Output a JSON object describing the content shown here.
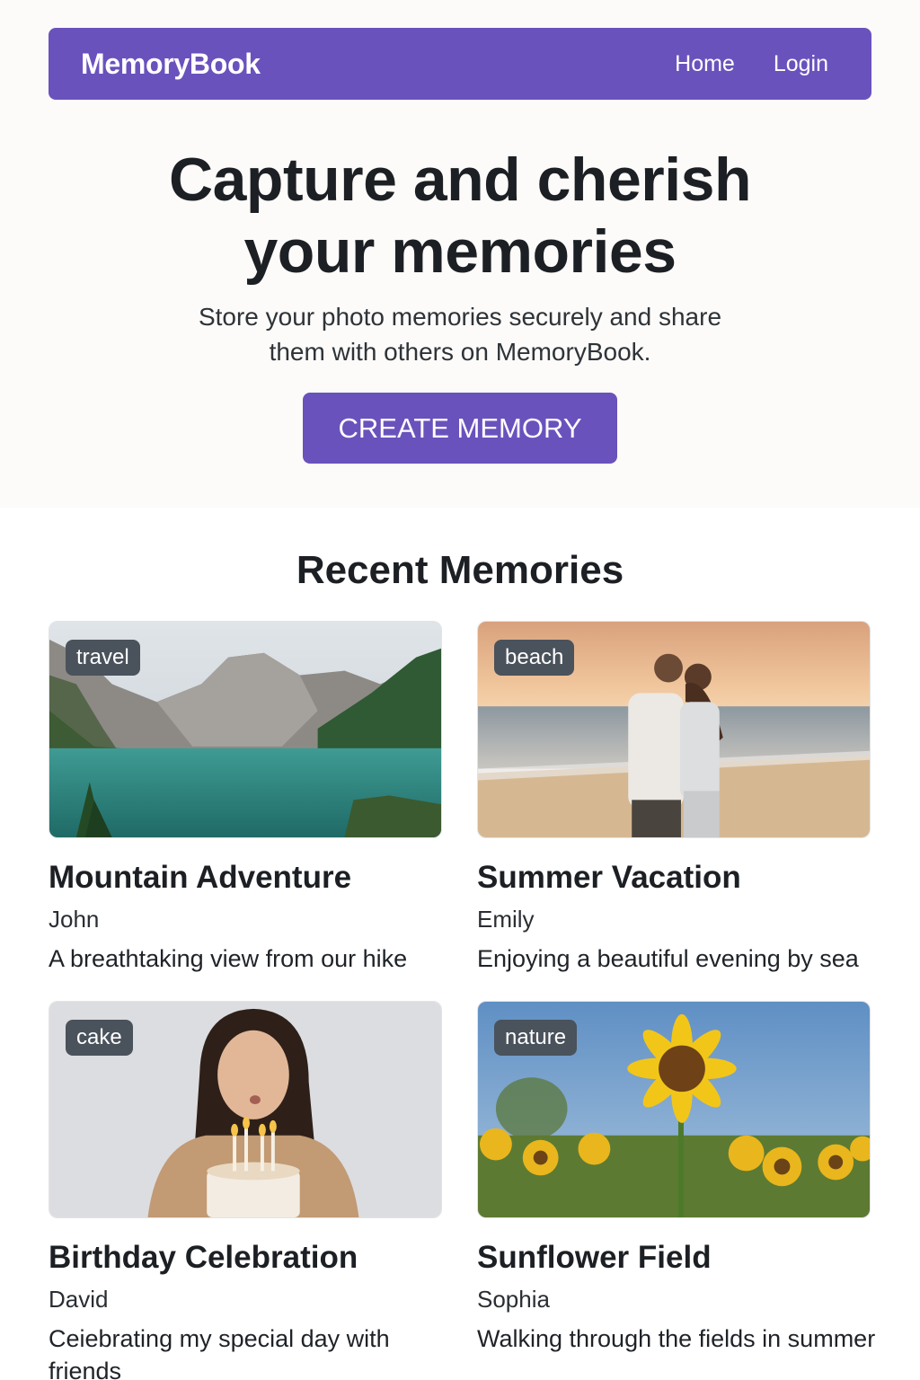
{
  "navbar": {
    "brand": "MemoryBook",
    "links": [
      "Home",
      "Login"
    ]
  },
  "hero": {
    "title_line1": "Capture and cherish",
    "title_line2": "your memories",
    "subtitle_line1": "Store your photo memories securely and share",
    "subtitle_line2": "them with others on MemoryBook.",
    "cta_label": "CREATE MEMORY"
  },
  "colors": {
    "accent": "#6a52bd",
    "tag_bg": "#4a525c",
    "hero_bg": "#fcfbf9"
  },
  "section": {
    "title": "Recent Memories"
  },
  "memories": [
    {
      "tag": "travel",
      "title": "Mountain Adventure",
      "author": "John",
      "description": "A breathtaking view from our hike",
      "image": "mountain-lake-photo"
    },
    {
      "tag": "beach",
      "title": "Summer Vacation",
      "author": "Emily",
      "description": "Enjoying a beautiful evening by sea",
      "image": "beach-couple-photo"
    },
    {
      "tag": "cake",
      "title": "Birthday Celebration",
      "author": "David",
      "description": "Ceiebrating my special day with friends",
      "image": "birthday-cake-photo"
    },
    {
      "tag": "nature",
      "title": "Sunflower Field",
      "author": "Sophia",
      "description": "Walking through the fields in summer",
      "image": "sunflower-field-photo"
    }
  ]
}
